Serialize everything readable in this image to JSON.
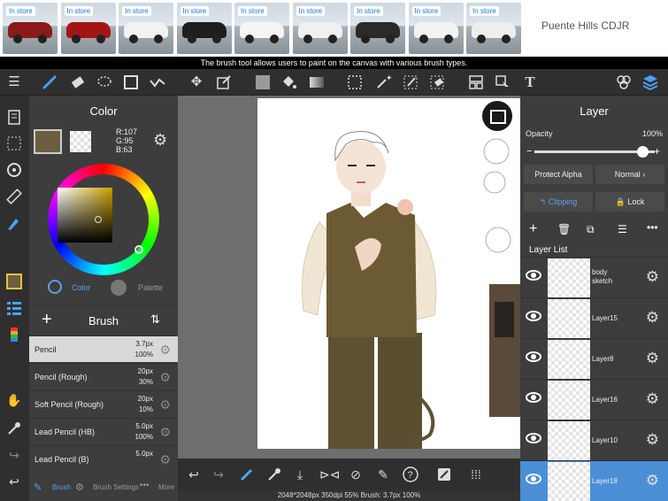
{
  "ad": {
    "badges": [
      "In store",
      "In store",
      "In store",
      "In store",
      "In store",
      "In store",
      "In store",
      "In store",
      "In store"
    ],
    "car_colors": [
      "#8b1a1a",
      "#a31515",
      "#f2f2f2",
      "#1e1e1e",
      "#f5f5f5",
      "#f0f0f0",
      "#2a2a2a",
      "#f3f3f3",
      "#eeeeee"
    ],
    "dealer": "Puente Hills CDJR"
  },
  "tooltip": "The brush tool allows users to paint on the canvas with various brush types.",
  "color_panel": {
    "title": "Color",
    "r": "R:107",
    "g": "G:95",
    "b": "B:63",
    "main_color": "#6b5f3f",
    "tab_color": "Color",
    "tab_palette": "Palette"
  },
  "brush_panel": {
    "title": "Brush",
    "brushes": [
      {
        "name": "Pencil",
        "size": "3.7px",
        "opacity": "100%"
      },
      {
        "name": "Pencil (Rough)",
        "size": "20px",
        "opacity": "30%"
      },
      {
        "name": "Soft Pencil (Rough)",
        "size": "20px",
        "opacity": "10%"
      },
      {
        "name": "Lead Pencil (HB)",
        "size": "5.0px",
        "opacity": "100%"
      },
      {
        "name": "Lead Pencil (B)",
        "size": "5.0px",
        "opacity": ""
      }
    ],
    "footer": {
      "brush": "Brush",
      "settings": "Brush Settings",
      "more": "More"
    }
  },
  "status": "2048*2048px 350dpi 55% Brush: 3.7px 100%",
  "layer_panel": {
    "title": "Layer",
    "opacity_label": "Opacity",
    "opacity_value": "100%",
    "protect_alpha": "Protect Alpha",
    "blend_mode": "Normal",
    "clipping": "Clipping",
    "lock": "Lock",
    "list_title": "Layer List",
    "layers": [
      {
        "name": "body sketch"
      },
      {
        "name": "Layer15"
      },
      {
        "name": "Layer8"
      },
      {
        "name": "Layer16"
      },
      {
        "name": "Layer10"
      },
      {
        "name": "Layer18"
      }
    ]
  }
}
